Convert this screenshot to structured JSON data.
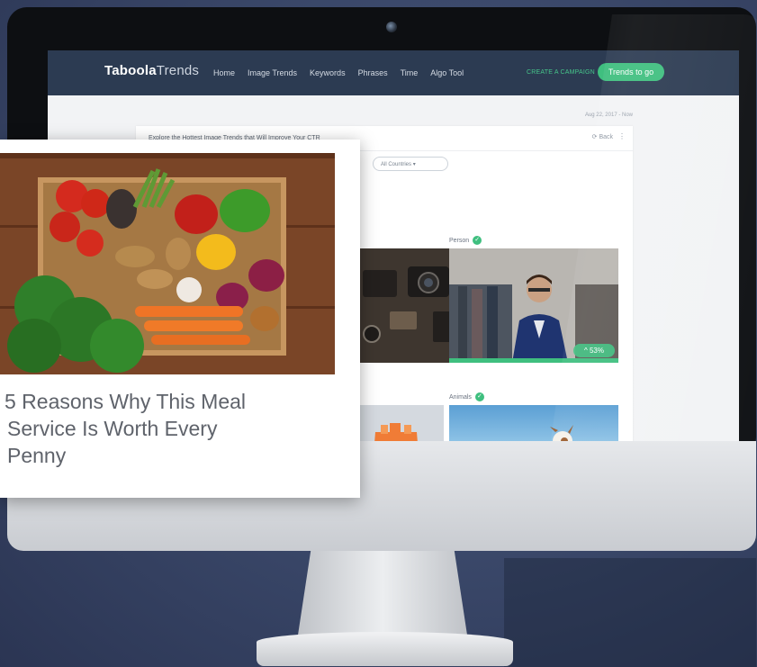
{
  "nav": {
    "logo_bold": "Taboola",
    "logo_thin": "Trends",
    "links": [
      "Home",
      "Image Trends",
      "Keywords",
      "Phrases",
      "Time",
      "Algo Tool"
    ],
    "create_campaign": "CREATE A CAMPAIGN",
    "trends_to_go": "Trends to go"
  },
  "main": {
    "date_label": "Aug 22, 2017 - Now",
    "card_title": "Explore the Hottest Image Trends that Will Improve Your CTR",
    "back_label": "Back",
    "menu_dots": "⋮",
    "country_select": "All Countries",
    "categories": [
      {
        "label": "Person",
        "badge": "53%"
      },
      {
        "label": "Animals"
      }
    ]
  },
  "ad": {
    "headline_line1": "5 Reasons Why This Meal",
    "headline_line2": "Service Is Worth Every",
    "headline_line3": "Penny"
  },
  "colors": {
    "nav_bg": "#2c3b52",
    "accent_green": "#3fbf7f",
    "screen_bg": "#f2f3f5"
  }
}
